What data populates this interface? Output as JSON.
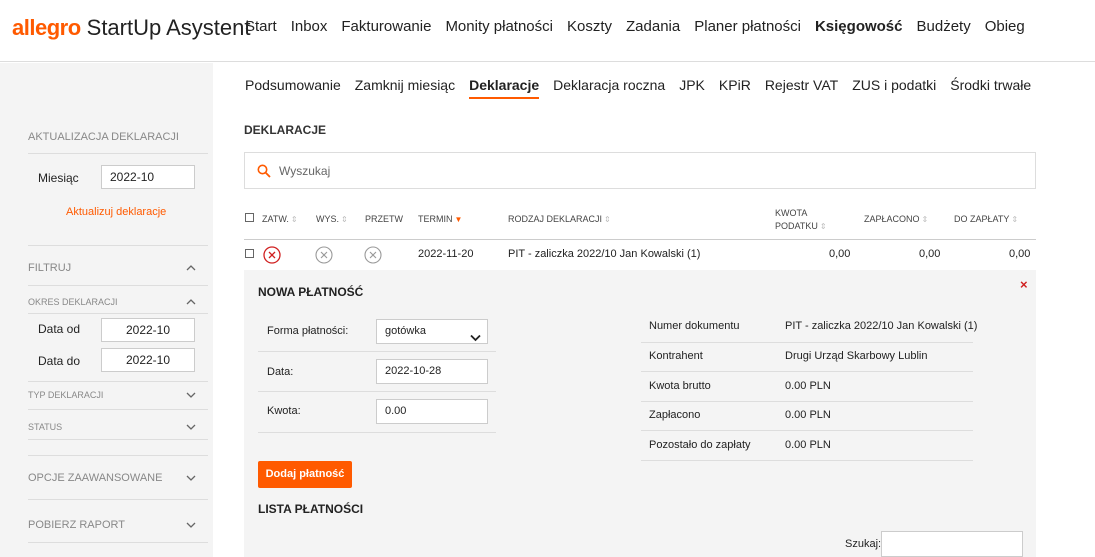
{
  "app": {
    "brand": "allegro",
    "product": "StartUp Asystent"
  },
  "mainnav": [
    "Start",
    "Inbox",
    "Fakturowanie",
    "Monity płatności",
    "Koszty",
    "Zadania",
    "Planer płatności",
    "Księgowość",
    "Budżety",
    "Obieg"
  ],
  "mainnav_active": "Księgowość",
  "subnav": [
    "Podsumowanie",
    "Zamknij miesiąc",
    "Deklaracje",
    "Deklaracja roczna",
    "JPK",
    "KPiR",
    "Rejestr VAT",
    "ZUS i podatki",
    "Środki trwałe"
  ],
  "subnav_active": "Deklaracje",
  "sidebar": {
    "update_heading": "AKTUALIZACJA DEKLARACJI",
    "month_label": "Miesiąc",
    "month_value": "2022-10",
    "update_link": "Aktualizuj deklaracje",
    "filter_heading": "FILTRUJ",
    "period_heading": "OKRES DEKLARACJI",
    "date_from_label": "Data od",
    "date_from_value": "2022-10",
    "date_to_label": "Data do",
    "date_to_value": "2022-10",
    "type_heading": "TYP DEKLARACJI",
    "status_heading": "STATUS",
    "advanced_heading": "OPCJE ZAAWANSOWANE",
    "report_heading": "POBIERZ RAPORT"
  },
  "content": {
    "title": "DEKLARACJE",
    "search_placeholder": "Wyszukaj"
  },
  "table": {
    "headers": {
      "approved": "ZATW.",
      "sent": "WYS.",
      "processed": "PRZETW",
      "due": "TERMIN",
      "type": "RODZAJ DEKLARACJI",
      "tax_line1": "KWOTA",
      "tax_line2": "PODATKU",
      "paid": "ZAPŁACONO",
      "to_pay": "DO ZAPŁATY"
    },
    "row": {
      "due": "2022-11-20",
      "type": "PIT - zaliczka 2022/10 Jan Kowalski (1)",
      "tax": "0,00",
      "paid": "0,00",
      "to_pay": "0,00"
    }
  },
  "payment": {
    "title": "NOWA PŁATNOŚĆ",
    "close": "×",
    "form_label": "Forma płatności:",
    "form_value": "gotówka",
    "date_label": "Data:",
    "date_value": "2022-10-28",
    "amount_label": "Kwota:",
    "amount_value": "0.00",
    "button": "Dodaj płatność",
    "details": [
      {
        "label": "Numer dokumentu",
        "value": "PIT - zaliczka 2022/10 Jan Kowalski (1)"
      },
      {
        "label": "Kontrahent",
        "value": "Drugi Urząd Skarbowy Lublin"
      },
      {
        "label": "Kwota brutto",
        "value": "0.00 PLN"
      },
      {
        "label": "Zapłacono",
        "value": "0.00 PLN"
      },
      {
        "label": "Pozostało do zapłaty",
        "value": "0.00 PLN"
      }
    ],
    "list_title": "LISTA PŁATNOŚCI",
    "list_search_label": "Szukaj:"
  },
  "colors": {
    "accent": "#ff5a00",
    "danger": "#d02020"
  },
  "icons": [
    "search-icon",
    "chevron-up-icon",
    "chevron-down-icon",
    "x-circle-icon",
    "close-icon",
    "sort-icon"
  ]
}
